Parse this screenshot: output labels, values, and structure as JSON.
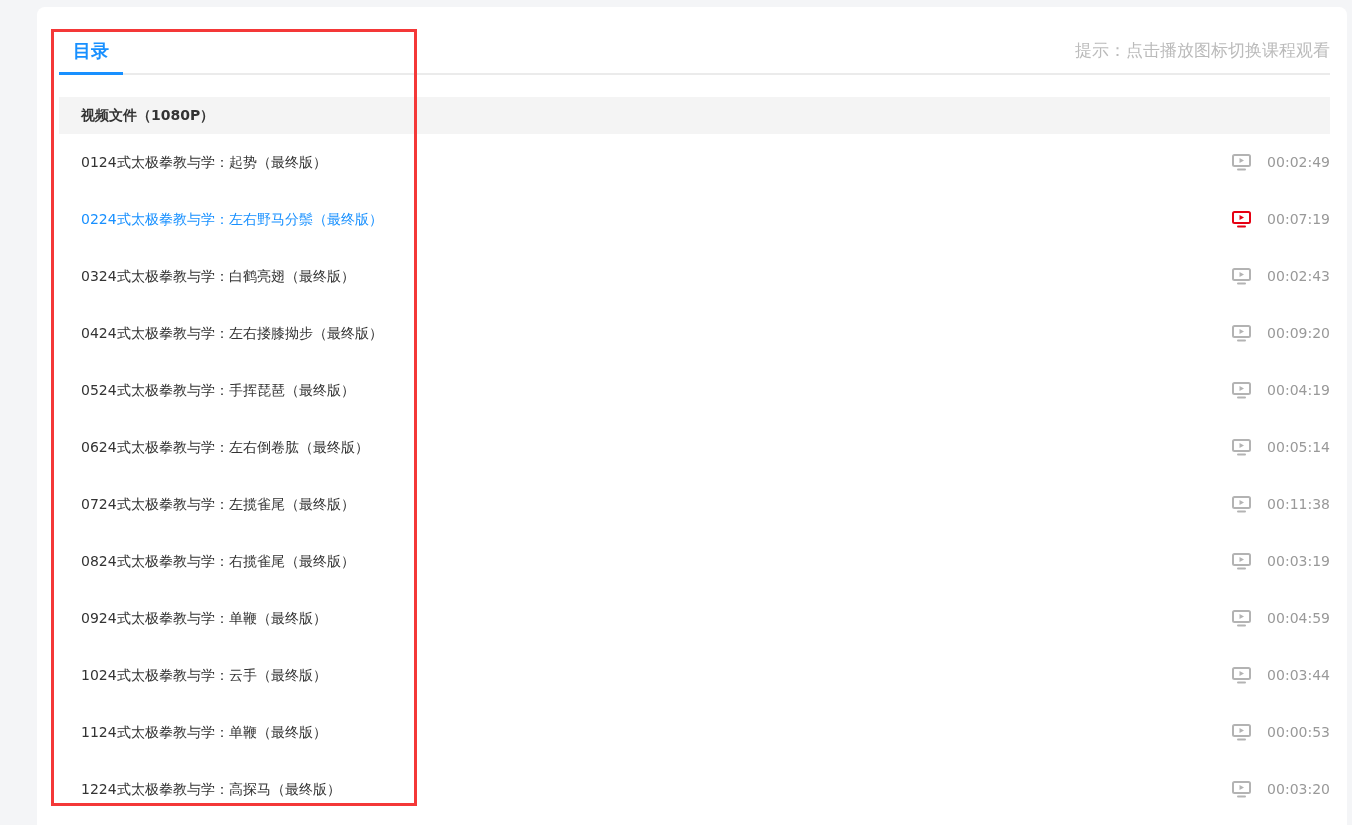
{
  "tabs": [
    {
      "label": "目录",
      "selected": true
    }
  ],
  "hint": "提示：点击播放图标切换课程观看",
  "section": {
    "title": "视频文件（1080P）"
  },
  "lessons": [
    {
      "title": "0124式太极拳教与学：起势（最终版）",
      "duration": "00:02:49",
      "selected": false
    },
    {
      "title": "0224式太极拳教与学：左右野马分鬃（最终版）",
      "duration": "00:07:19",
      "selected": true
    },
    {
      "title": "0324式太极拳教与学：白鹤亮翅（最终版）",
      "duration": "00:02:43",
      "selected": false
    },
    {
      "title": "0424式太极拳教与学：左右搂膝拗步（最终版）",
      "duration": "00:09:20",
      "selected": false
    },
    {
      "title": "0524式太极拳教与学：手挥琵琶（最终版）",
      "duration": "00:04:19",
      "selected": false
    },
    {
      "title": "0624式太极拳教与学：左右倒卷肱（最终版）",
      "duration": "00:05:14",
      "selected": false
    },
    {
      "title": "0724式太极拳教与学：左揽雀尾（最终版）",
      "duration": "00:11:38",
      "selected": false
    },
    {
      "title": "0824式太极拳教与学：右揽雀尾（最终版）",
      "duration": "00:03:19",
      "selected": false
    },
    {
      "title": "0924式太极拳教与学：单鞭（最终版）",
      "duration": "00:04:59",
      "selected": false
    },
    {
      "title": "1024式太极拳教与学：云手（最终版）",
      "duration": "00:03:44",
      "selected": false
    },
    {
      "title": "1124式太极拳教与学：单鞭（最终版）",
      "duration": "00:00:53",
      "selected": false
    },
    {
      "title": "1224式太极拳教与学：高探马（最终版）",
      "duration": "00:03:20",
      "selected": false
    }
  ]
}
